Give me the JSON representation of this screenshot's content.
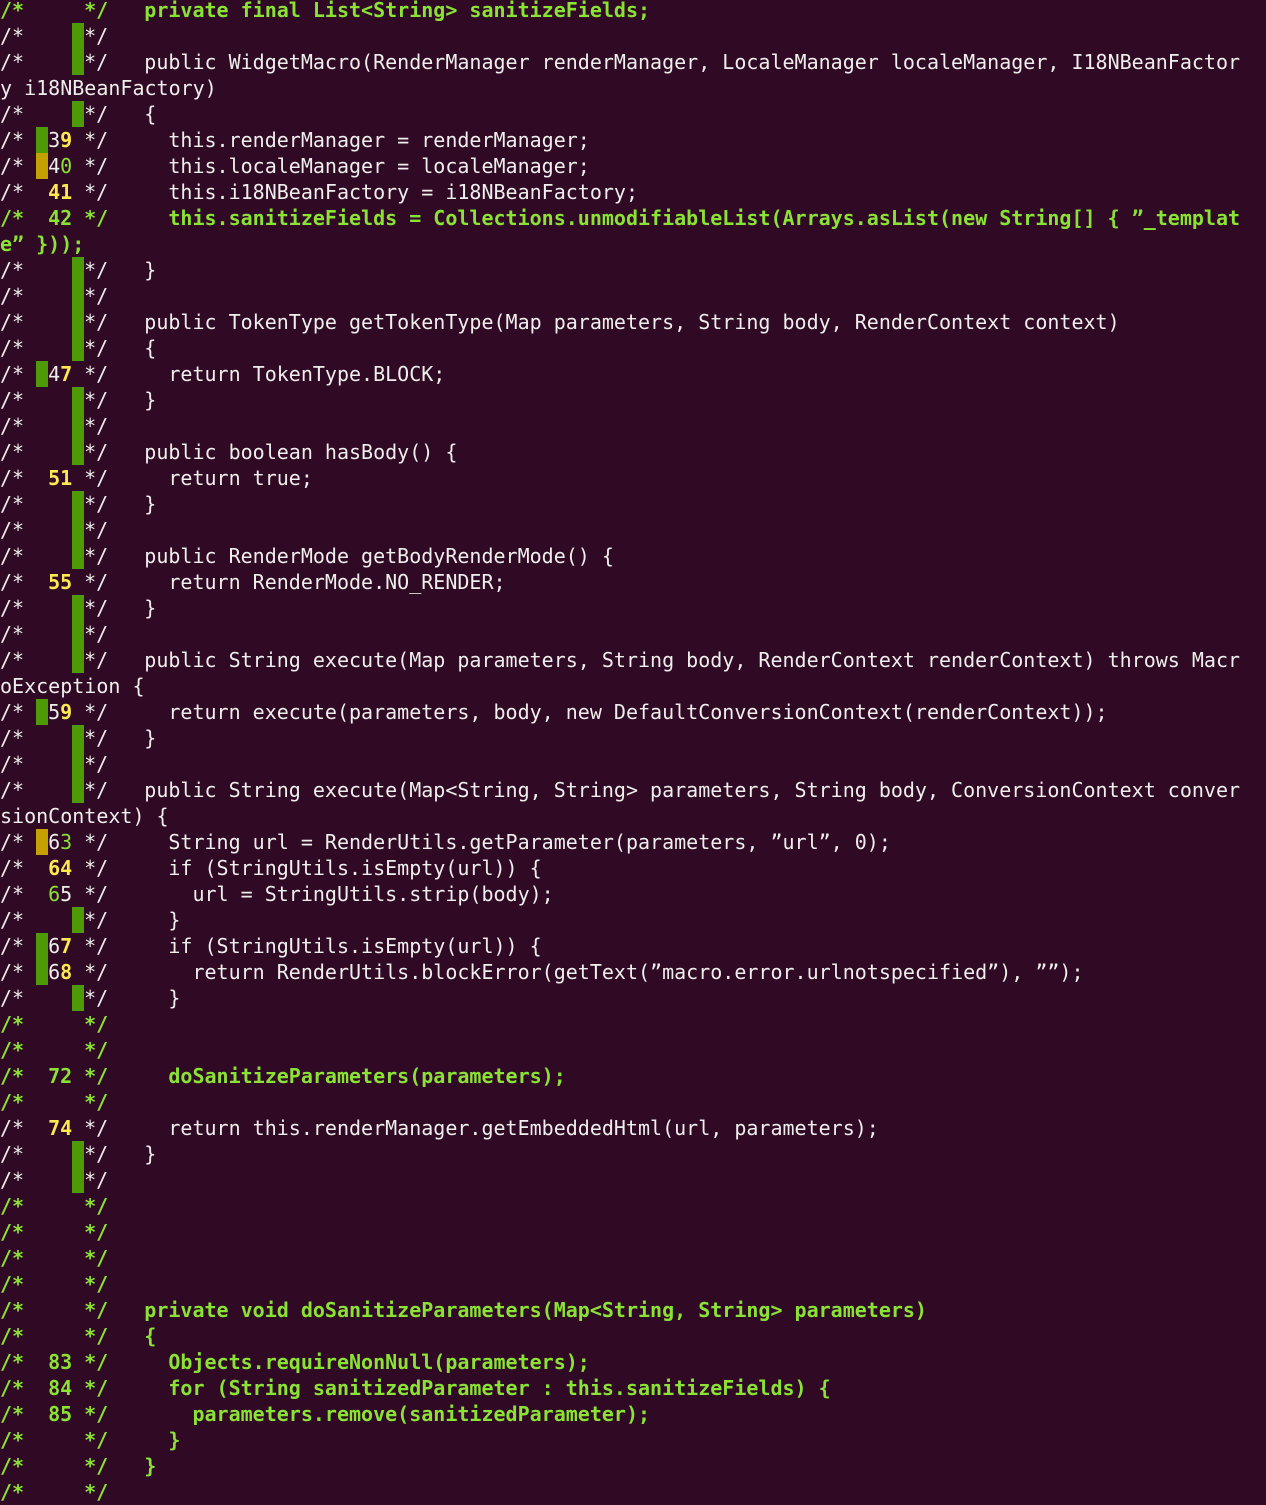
{
  "colors": {
    "background": "#300a24",
    "text": "#eeeeec",
    "added": "#8ae234",
    "number_highlight": "#fce94f",
    "bar_green": "#4e9a06",
    "bar_amber": "#c4a000"
  },
  "lines": [
    {
      "hl": true,
      "code": "   private final List<String> sanitizeFields;"
    },
    {
      "b6": "g",
      "code": ""
    },
    {
      "b6": "g",
      "code": "   public WidgetMacro(RenderManager renderManager, LocaleManager localeManager, I18NBeanFactor"
    },
    {
      "cont": true,
      "code": "y i18NBeanFactory)"
    },
    {
      "b6": "g",
      "code": "   {"
    },
    {
      "b3": "g",
      "num": "39",
      "nc": "wy",
      "code": "     this.renderManager = renderManager;"
    },
    {
      "b3": "a",
      "num": "40",
      "nc": "wg",
      "code": "     this.localeManager = localeManager;"
    },
    {
      "num": "41",
      "nc": "yy",
      "code": "     this.i18NBeanFactory = i18NBeanFactory;"
    },
    {
      "hl": true,
      "num": "42",
      "code": "     this.sanitizeFields = Collections.unmodifiableList(Arrays.asList(new String[] { ”_templat"
    },
    {
      "cont": true,
      "hl": true,
      "code": "e” }));"
    },
    {
      "b6": "g",
      "code": "   }"
    },
    {
      "b6": "g",
      "code": ""
    },
    {
      "b6": "g",
      "code": "   public TokenType getTokenType(Map parameters, String body, RenderContext context)"
    },
    {
      "b6": "g",
      "code": "   {"
    },
    {
      "b3": "g",
      "num": "47",
      "nc": "wy",
      "code": "     return TokenType.BLOCK;"
    },
    {
      "b6": "g",
      "code": "   }"
    },
    {
      "b6": "g",
      "code": ""
    },
    {
      "b6": "g",
      "code": "   public boolean hasBody() {"
    },
    {
      "num": "51",
      "nc": "yy",
      "code": "     return true;"
    },
    {
      "b6": "g",
      "code": "   }"
    },
    {
      "b6": "g",
      "code": ""
    },
    {
      "b6": "g",
      "code": "   public RenderMode getBodyRenderMode() {"
    },
    {
      "num": "55",
      "nc": "yy",
      "code": "     return RenderMode.NO_RENDER;"
    },
    {
      "b6": "g",
      "code": "   }"
    },
    {
      "b6": "g",
      "code": ""
    },
    {
      "b6": "g",
      "code": "   public String execute(Map parameters, String body, RenderContext renderContext) throws Macr"
    },
    {
      "cont": true,
      "code": "oException {"
    },
    {
      "b3": "g",
      "num": "59",
      "nc": "wy",
      "code": "     return execute(parameters, body, new DefaultConversionContext(renderContext));"
    },
    {
      "b6": "g",
      "code": "   }"
    },
    {
      "b6": "g",
      "code": ""
    },
    {
      "b6": "g",
      "code": "   public String execute(Map<String, String> parameters, String body, ConversionContext conver"
    },
    {
      "cont": true,
      "code": "sionContext) {"
    },
    {
      "b3": "a",
      "num": "63",
      "nc": "wg",
      "code": "     String url = RenderUtils.getParameter(parameters, ”url”, 0);"
    },
    {
      "num": "64",
      "nc": "yy",
      "code": "     if (StringUtils.isEmpty(url)) {"
    },
    {
      "num": "65",
      "nc": "gw",
      "code": "       url = StringUtils.strip(body);"
    },
    {
      "b6": "g",
      "code": "     }"
    },
    {
      "b3": "g",
      "num": "67",
      "nc": "wy",
      "code": "     if (StringUtils.isEmpty(url)) {"
    },
    {
      "b3": "g",
      "num": "68",
      "nc": "wy",
      "code": "       return RenderUtils.blockError(getText(”macro.error.urlnotspecified”), ””);"
    },
    {
      "b6": "g",
      "code": "     }"
    },
    {
      "hl": true,
      "code": ""
    },
    {
      "hl": true,
      "code": ""
    },
    {
      "hl": true,
      "num": "72",
      "code": "     doSanitizeParameters(parameters);"
    },
    {
      "hl": true,
      "code": ""
    },
    {
      "num": "74",
      "nc": "yy",
      "code": "     return this.renderManager.getEmbeddedHtml(url, parameters);"
    },
    {
      "b6": "g",
      "code": "   }"
    },
    {
      "b6": "g",
      "code": ""
    },
    {
      "hl": true,
      "code": ""
    },
    {
      "hl": true,
      "code": ""
    },
    {
      "hl": true,
      "code": ""
    },
    {
      "hl": true,
      "code": ""
    },
    {
      "hl": true,
      "code": "   private void doSanitizeParameters(Map<String, String> parameters)"
    },
    {
      "hl": true,
      "code": "   {"
    },
    {
      "hl": true,
      "num": "83",
      "code": "     Objects.requireNonNull(parameters);"
    },
    {
      "hl": true,
      "num": "84",
      "code": "     for (String sanitizedParameter : this.sanitizeFields) {"
    },
    {
      "hl": true,
      "num": "85",
      "code": "       parameters.remove(sanitizedParameter);"
    },
    {
      "hl": true,
      "code": "     }"
    },
    {
      "hl": true,
      "code": "   }"
    },
    {
      "hl": true,
      "code": ""
    }
  ]
}
